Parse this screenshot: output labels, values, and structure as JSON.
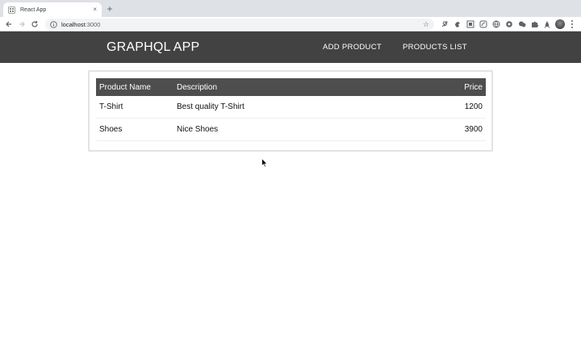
{
  "browser": {
    "tab_title": "React App",
    "tab_close": "×",
    "new_tab": "+",
    "url_host": "localhost",
    "url_port": ":3000",
    "bookmark_icon": "star-outline-icon"
  },
  "navbar": {
    "brand": "GRAPHQL APP",
    "links": [
      {
        "label": "ADD PRODUCT"
      },
      {
        "label": "PRODUCTS LIST"
      }
    ]
  },
  "products": {
    "columns": [
      "Product Name",
      "Description",
      "Price"
    ],
    "rows": [
      {
        "name": "T-Shirt",
        "description": "Best quality T-Shirt",
        "price": "1200"
      },
      {
        "name": "Shoes",
        "description": "Nice Shoes",
        "price": "3900"
      }
    ]
  },
  "colors": {
    "navbar_bg": "#424242",
    "table_header_bg": "#4e4e4e",
    "tabstrip_bg": "#dee1e6"
  }
}
